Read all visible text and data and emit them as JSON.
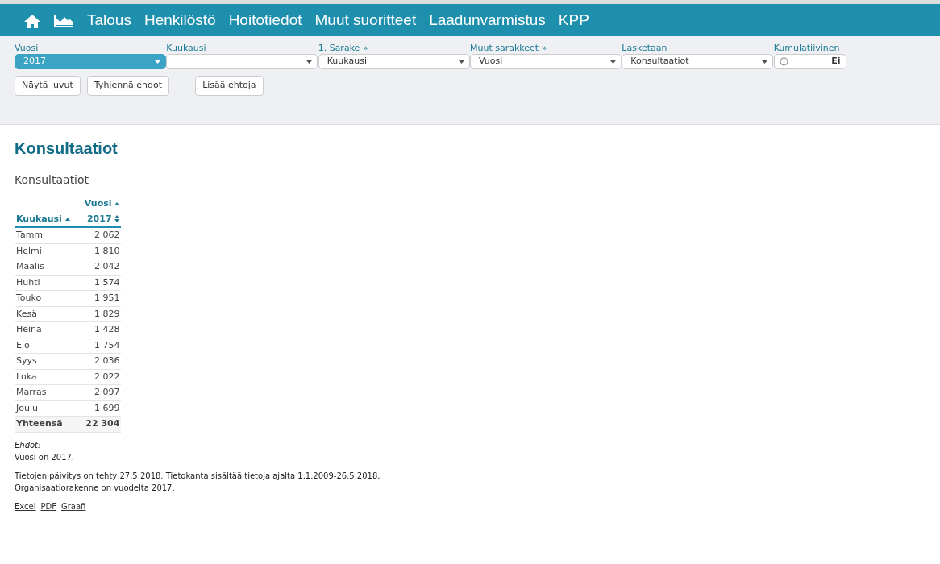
{
  "nav": {
    "items": [
      "Talous",
      "Henkilöstö",
      "Hoitotiedot",
      "Muut suoritteet",
      "Laadunvarmistus",
      "KPP"
    ]
  },
  "filters": [
    {
      "kind": "select",
      "label": "Vuosi",
      "value": "2017",
      "active": true
    },
    {
      "kind": "select",
      "label": "Kuukausi",
      "active": false
    },
    {
      "kind": "select",
      "label": "1. Sarake »",
      "value": "Kuukausi",
      "active": false
    },
    {
      "kind": "select",
      "label": "Muut sarakkeet »",
      "value": "Vuosi",
      "active": false
    },
    {
      "kind": "select",
      "label": "Lasketaan",
      "value": "Konsultaatiot",
      "active": false
    },
    {
      "kind": "toggle",
      "label": "Kumulatiivinen",
      "value": "Ei",
      "on": false
    }
  ],
  "buttons": [
    "Näytä luvut",
    "Tyhjennä ehdot"
  ],
  "extra_button": "Lisää ehtoja",
  "heading": "Konsultaatiot",
  "subheading": "Konsultaatiot",
  "table": {
    "group_header": "Vuosi",
    "columns": [
      "Kuukausi",
      "2017"
    ],
    "rows": [
      [
        "Tammi",
        "2 062"
      ],
      [
        "Helmi",
        "1 810"
      ],
      [
        "Maalis",
        "2 042"
      ],
      [
        "Huhti",
        "1 574"
      ],
      [
        "Touko",
        "1 951"
      ],
      [
        "Kesä",
        "1 829"
      ],
      [
        "Heinä",
        "1 428"
      ],
      [
        "Elo",
        "1 754"
      ],
      [
        "Syys",
        "2 036"
      ],
      [
        "Loka",
        "2 022"
      ],
      [
        "Marras",
        "2 097"
      ],
      [
        "Joulu",
        "1 699"
      ]
    ],
    "total": [
      "Yhteensä",
      "22 304"
    ]
  },
  "conditions_title": "Ehdot:",
  "conditions": "Vuosi on 2017.",
  "notes": [
    "Tietojen päivitys on tehty 27.5.2018. Tietokanta sisältää tietoja ajalta 1.1.2009-26.5.2018.",
    "Organisaatiorakenne on vuodelta 2017."
  ],
  "links": [
    "Excel",
    "PDF",
    "Graafi"
  ]
}
